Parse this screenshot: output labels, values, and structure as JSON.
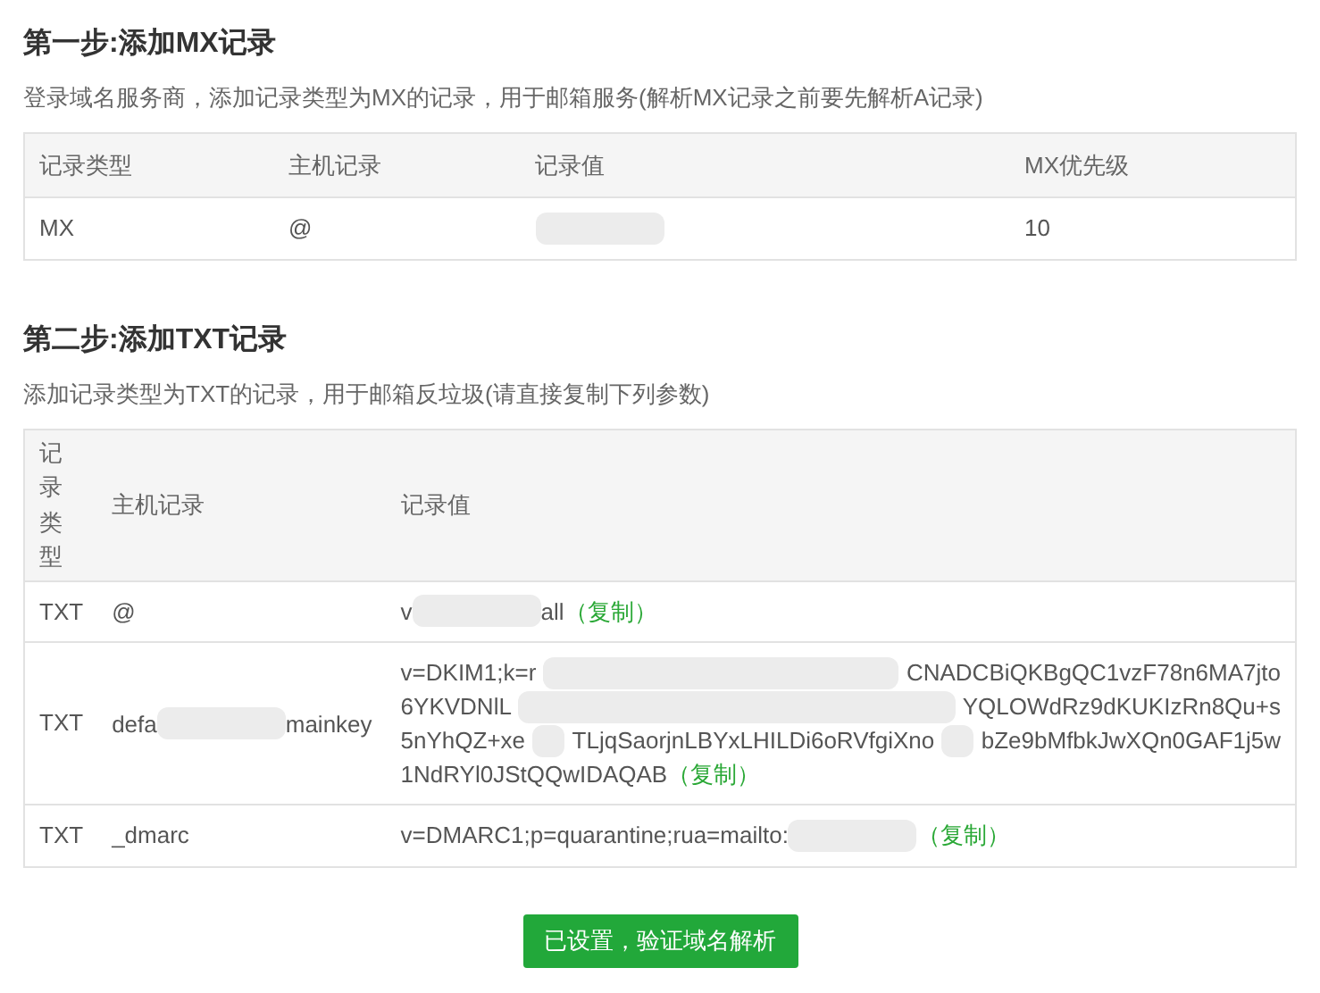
{
  "step1": {
    "title": "第一步:添加MX记录",
    "description": "登录域名服务商，添加记录类型为MX的记录，用于邮箱服务(解析MX记录之前要先解析A记录)",
    "table": {
      "columns": [
        "记录类型",
        "主机记录",
        "记录值",
        "MX优先级"
      ],
      "rows": [
        {
          "type": "MX",
          "host": [
            {
              "kind": "text",
              "text": "@"
            }
          ],
          "value": [
            [
              {
                "kind": "redacted"
              }
            ]
          ],
          "priority": "10"
        }
      ]
    }
  },
  "step2": {
    "title": "第二步:添加TXT记录",
    "description": "添加记录类型为TXT的记录，用于邮箱反垃圾(请直接复制下列参数)",
    "table": {
      "columns": [
        "记录类型",
        "主机记录",
        "记录值"
      ],
      "rows": [
        {
          "type": "TXT",
          "host": [
            {
              "kind": "text",
              "text": "@"
            }
          ],
          "value": [
            [
              {
                "kind": "text",
                "text": "v"
              },
              {
                "kind": "redacted"
              },
              {
                "kind": "text",
                "text": "all"
              },
              {
                "kind": "copy",
                "text": "（复制）"
              }
            ]
          ]
        },
        {
          "type": "TXT",
          "host": [
            {
              "kind": "text",
              "text": "defa"
            },
            {
              "kind": "redacted"
            },
            {
              "kind": "text",
              "text": "mainkey"
            }
          ],
          "value": [
            [
              {
                "kind": "text",
                "text": "v=DKIM1;k=r"
              },
              {
                "kind": "redacted"
              },
              {
                "kind": "text",
                "text": "CNADCBiQKBgQC1vzF78n6MA7jto"
              }
            ],
            [
              {
                "kind": "text",
                "text": "6YKVDNlL"
              },
              {
                "kind": "redacted"
              },
              {
                "kind": "text",
                "text": "YQLOWdRz9dKUKIzRn8Qu+s"
              }
            ],
            [
              {
                "kind": "text",
                "text": "5nYhQZ+xe"
              },
              {
                "kind": "redacted"
              },
              {
                "kind": "text",
                "text": "TLjqSaorjnLBYxLHILDi6oRVfgiXno"
              },
              {
                "kind": "redacted"
              },
              {
                "kind": "text",
                "text": "bZe9bMfbkJwXQn0GAF1j5w"
              }
            ],
            [
              {
                "kind": "text",
                "text": "1NdRYl0JStQQwIDAQAB"
              },
              {
                "kind": "copy",
                "text": "（复制）"
              }
            ]
          ]
        },
        {
          "type": "TXT",
          "host": [
            {
              "kind": "text",
              "text": "_dmarc"
            }
          ],
          "value": [
            [
              {
                "kind": "text",
                "text": "v=DMARC1;p=quarantine;rua=mailto:"
              },
              {
                "kind": "redacted"
              },
              {
                "kind": "copy",
                "text": "（复制）"
              }
            ]
          ]
        }
      ]
    }
  },
  "verify_button": "已设置，验证域名解析"
}
